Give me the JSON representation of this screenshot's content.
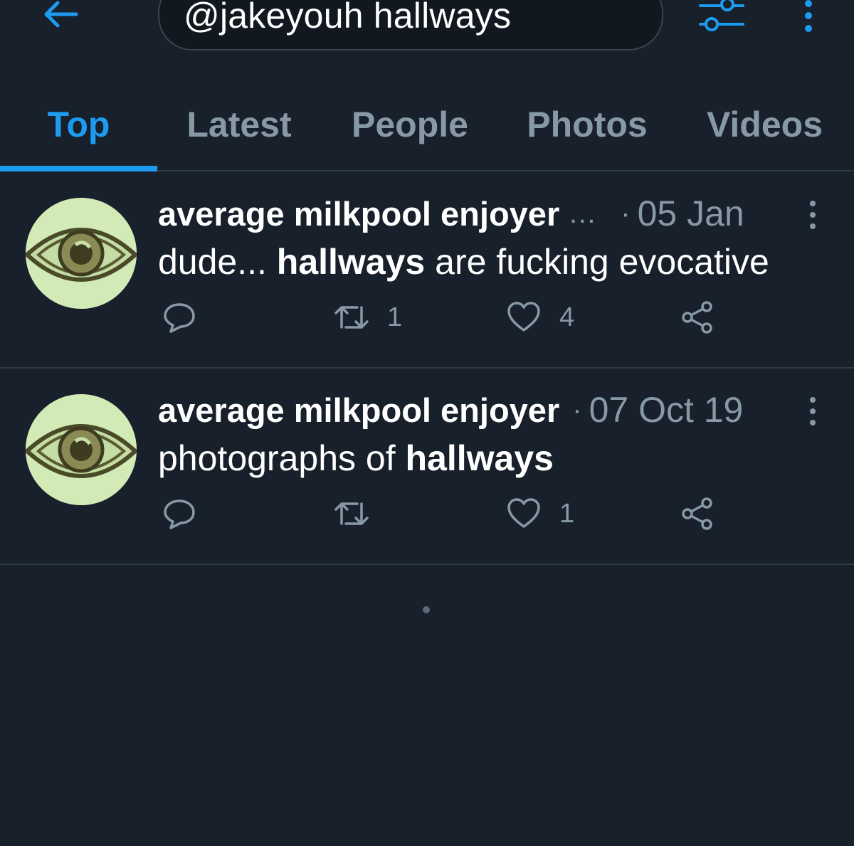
{
  "search": {
    "query": "@jakeyouh hallways"
  },
  "tabs": [
    {
      "label": "Top",
      "active": true
    },
    {
      "label": "Latest",
      "active": false
    },
    {
      "label": "People",
      "active": false
    },
    {
      "label": "Photos",
      "active": false
    },
    {
      "label": "Videos",
      "active": false
    }
  ],
  "tweets": [
    {
      "display_name": "average milkpool enjoyer",
      "truncated_marker": "…",
      "separator": "·",
      "timestamp": "05 Jan",
      "text_before": "dude... ",
      "text_highlight": "hallways",
      "text_after": " are fucking evocative",
      "retweets": "1",
      "likes": "4"
    },
    {
      "display_name": "average milkpool enjoyer",
      "separator": "·",
      "timestamp": "07 Oct 19",
      "text_before": "photographs of ",
      "text_highlight": "hallways",
      "text_after": "",
      "likes": "1"
    }
  ],
  "colors": {
    "background": "#17202b",
    "accent": "#1d9bf0",
    "muted": "#8899a6",
    "divider": "#2e3a45"
  },
  "icons": [
    "back-arrow-icon",
    "filter-sliders-icon",
    "more-vertical-icon",
    "reply-icon",
    "retweet-icon",
    "like-heart-icon",
    "share-icon",
    "avatar-eye-icon"
  ]
}
